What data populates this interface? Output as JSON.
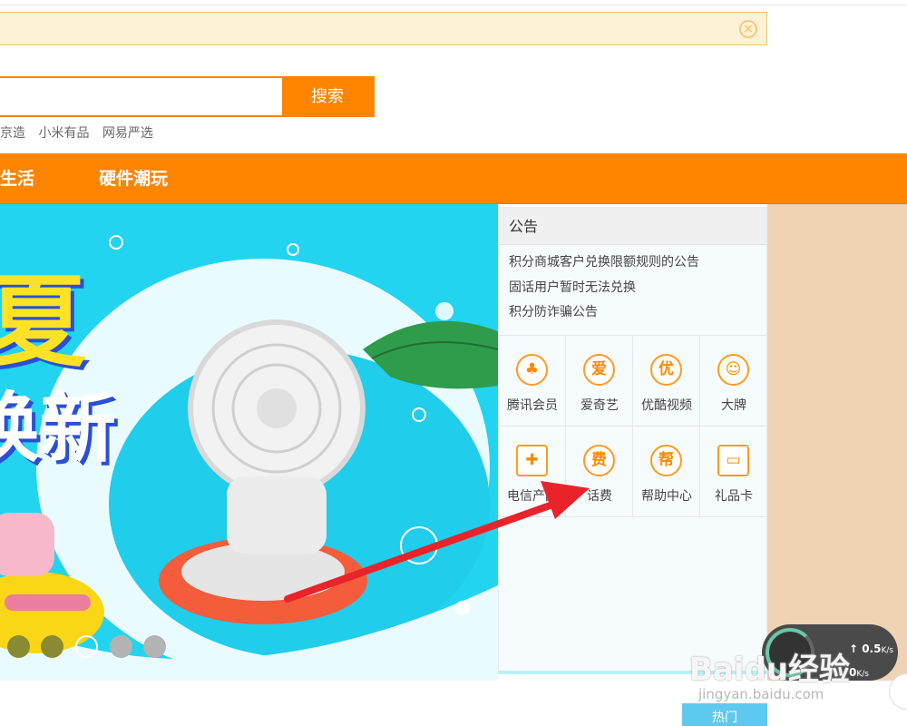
{
  "notice_bar": {
    "close_icon": "close-circle-icon"
  },
  "search": {
    "placeholder": "",
    "button_label": "搜索"
  },
  "hot_links": [
    "京造",
    "小米有品",
    "网易严选"
  ],
  "nav": {
    "items": [
      "生活",
      "硬件潮玩"
    ]
  },
  "banner": {
    "headline_1": "夏",
    "headline_2": "焕新",
    "dots": 5
  },
  "panel": {
    "title": "公告",
    "announcements": [
      "积分商城客户兑换限额规则的公告",
      "固话用户暂时无法兑换",
      "积分防诈骗公告"
    ],
    "grid": [
      {
        "label": "腾讯会员",
        "glyph": "♣",
        "icon": "penguin-icon"
      },
      {
        "label": "爱奇艺",
        "glyph": "爱",
        "icon": "iqiyi-icon"
      },
      {
        "label": "优酷视频",
        "glyph": "优",
        "icon": "youku-icon"
      },
      {
        "label": "大牌",
        "glyph": "☺",
        "icon": "brand-badge-icon"
      },
      {
        "label": "电信产品",
        "glyph": "✚",
        "icon": "gift-box-icon"
      },
      {
        "label": "话费",
        "glyph": "费",
        "icon": "phone-bill-icon"
      },
      {
        "label": "帮助中心",
        "glyph": "帮",
        "icon": "help-icon"
      },
      {
        "label": "礼品卡",
        "glyph": "▭",
        "icon": "gift-card-icon"
      }
    ]
  },
  "speed_widget": {
    "upload": "0.5",
    "download": "0",
    "unit": "K/s"
  },
  "watermark": {
    "main": "Baidu经验",
    "sub": "jingyan.baidu.com"
  },
  "hot_button": {
    "label": "热门"
  },
  "colors": {
    "accent": "#ff8400",
    "banner": "#22d4ef",
    "arrow": "#e8232a"
  }
}
